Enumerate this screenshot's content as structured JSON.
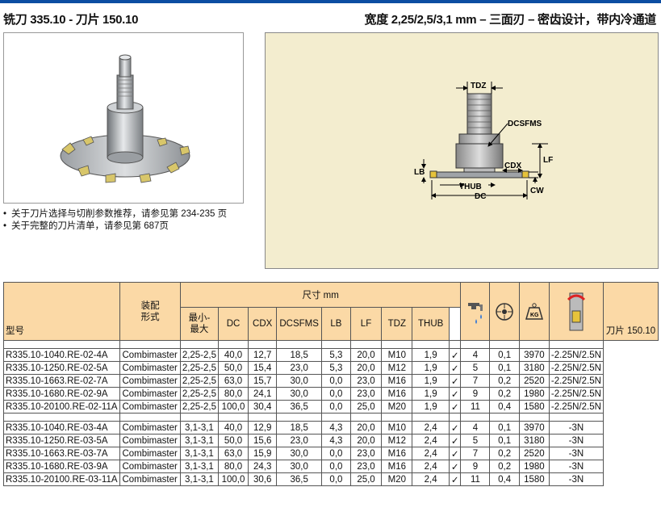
{
  "header": {
    "title_left": "铣刀 335.10 - 刀片 150.10",
    "title_right": "宽度 2,25/2,5/3,1 mm – 三面刃 – 密齿设计，带内冷通道"
  },
  "notes": [
    "关于刀片选择与切削参数推荐，请参见第 234-235 页",
    "关于完整的刀片清单，请参见第 687页"
  ],
  "diagram": {
    "labels": {
      "tdz": "TDZ",
      "dcsfms": "DCSFMS",
      "lf": "LF",
      "lb": "LB",
      "cdx": "CDX",
      "thub": "THUB",
      "dc": "DC",
      "cw": "CW"
    }
  },
  "table": {
    "headers": {
      "model": "型号",
      "mount": "装配\n形式",
      "dims": "尺寸 mm",
      "cw": "最小-\n最大",
      "dc": "DC",
      "cdx": "CDX",
      "dcsfms": "DCSFMS",
      "lb": "LB",
      "lf": "LF",
      "tdz": "TDZ",
      "thub": "THUB",
      "kg": "KG",
      "insert": "刀片 150.10"
    },
    "rows_group1": [
      [
        "R335.10-1040.RE-02-4A",
        "Combimaster",
        "2,25-2,5",
        "40,0",
        "12,7",
        "18,5",
        "5,3",
        "20,0",
        "M10",
        "1,9",
        "✓",
        "4",
        "0,1",
        "3970",
        "-2.25N/2.5N"
      ],
      [
        "R335.10-1250.RE-02-5A",
        "Combimaster",
        "2,25-2,5",
        "50,0",
        "15,4",
        "23,0",
        "5,3",
        "20,0",
        "M12",
        "1,9",
        "✓",
        "5",
        "0,1",
        "3180",
        "-2.25N/2.5N"
      ],
      [
        "R335.10-1663.RE-02-7A",
        "Combimaster",
        "2,25-2,5",
        "63,0",
        "15,7",
        "30,0",
        "0,0",
        "23,0",
        "M16",
        "1,9",
        "✓",
        "7",
        "0,2",
        "2520",
        "-2.25N/2.5N"
      ],
      [
        "R335.10-1680.RE-02-9A",
        "Combimaster",
        "2,25-2,5",
        "80,0",
        "24,1",
        "30,0",
        "0,0",
        "23,0",
        "M16",
        "1,9",
        "✓",
        "9",
        "0,2",
        "1980",
        "-2.25N/2.5N"
      ],
      [
        "R335.10-20100.RE-02-11A",
        "Combimaster",
        "2,25-2,5",
        "100,0",
        "30,4",
        "36,5",
        "0,0",
        "25,0",
        "M20",
        "1,9",
        "✓",
        "11",
        "0,4",
        "1580",
        "-2.25N/2.5N"
      ]
    ],
    "rows_group2": [
      [
        "R335.10-1040.RE-03-4A",
        "Combimaster",
        "3,1-3,1",
        "40,0",
        "12,9",
        "18,5",
        "4,3",
        "20,0",
        "M10",
        "2,4",
        "✓",
        "4",
        "0,1",
        "3970",
        "-3N"
      ],
      [
        "R335.10-1250.RE-03-5A",
        "Combimaster",
        "3,1-3,1",
        "50,0",
        "15,6",
        "23,0",
        "4,3",
        "20,0",
        "M12",
        "2,4",
        "✓",
        "5",
        "0,1",
        "3180",
        "-3N"
      ],
      [
        "R335.10-1663.RE-03-7A",
        "Combimaster",
        "3,1-3,1",
        "63,0",
        "15,9",
        "30,0",
        "0,0",
        "23,0",
        "M16",
        "2,4",
        "✓",
        "7",
        "0,2",
        "2520",
        "-3N"
      ],
      [
        "R335.10-1680.RE-03-9A",
        "Combimaster",
        "3,1-3,1",
        "80,0",
        "24,3",
        "30,0",
        "0,0",
        "23,0",
        "M16",
        "2,4",
        "✓",
        "9",
        "0,2",
        "1980",
        "-3N"
      ],
      [
        "R335.10-20100.RE-03-11A",
        "Combimaster",
        "3,1-3,1",
        "100,0",
        "30,6",
        "36,5",
        "0,0",
        "25,0",
        "M20",
        "2,4",
        "✓",
        "11",
        "0,4",
        "1580",
        "-3N"
      ]
    ]
  },
  "colors": {
    "accent": "#0c4da2",
    "header_bg": "#fbd9a6",
    "diagram_bg": "#f3edcf"
  },
  "icons": [
    "coolant-icon",
    "teeth-count-icon",
    "weight-icon",
    "rpm-icon"
  ]
}
